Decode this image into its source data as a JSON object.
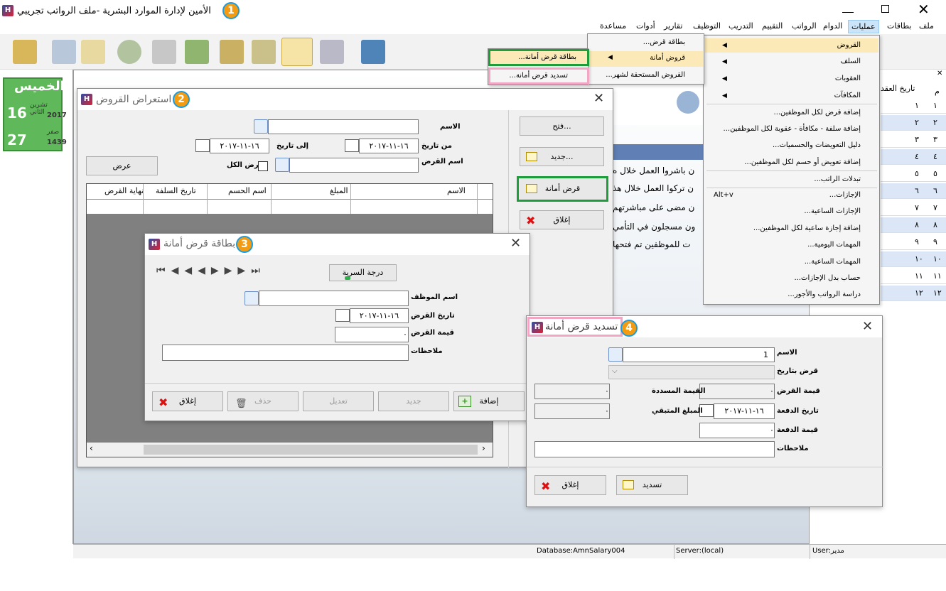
{
  "app": {
    "title": "الأمين لإدارة الموارد البشرية -ملف الرواتب تجريبي",
    "markers": [
      "1",
      "2",
      "3",
      "4"
    ]
  },
  "menubar": {
    "items": [
      "ملف",
      "بطاقات",
      "عمليات",
      "الدوام",
      "الرواتب",
      "التقييم",
      "التدريب",
      "التوظيف",
      "تقارير",
      "أدوات",
      "مساعدة"
    ]
  },
  "calendar": {
    "day": "الخميس",
    "greg_day": "16",
    "greg_month": "تشرين الثاني",
    "greg_year": "2017",
    "hijri_day": "27",
    "hijri_month": "صفر",
    "hijri_year": "1439"
  },
  "operations_menu": {
    "items": [
      {
        "label": "القروض",
        "has_sub": true,
        "highlighted": true
      },
      {
        "label": "السلف",
        "has_sub": true
      },
      {
        "label": "العقوبات",
        "has_sub": true
      },
      {
        "label": "المكافآت",
        "has_sub": true
      },
      {
        "label": "إضافة قرض لكل الموظفين..."
      },
      {
        "label": "إضافة سلفة - مكافأة - عقوبة لكل الموظفين..."
      },
      {
        "label": "دليل التعويضات والحسميات..."
      },
      {
        "label": "إضافة تعويض أو حسم لكل الموظفين..."
      },
      {
        "label": "تبدلات الراتب..."
      },
      {
        "label": "الإجازات...",
        "shortcut": "Alt+v"
      },
      {
        "label": "الإجازات الساعية..."
      },
      {
        "label": "إضافة إجازة ساعية لكل الموظفين..."
      },
      {
        "label": "المهمات اليومية..."
      },
      {
        "label": "المهمات الساعية..."
      },
      {
        "label": "حساب بدل الإجازات..."
      },
      {
        "label": "دراسة الرواتب والأجور..."
      }
    ]
  },
  "loans_submenu": {
    "items": [
      "بطاقة قرض...",
      "قروض أمانة",
      "القروض المستحقة لشهر..."
    ]
  },
  "amana_submenu": {
    "items": [
      "بطاقة قرض أمانة...",
      "تسديد قرض أمانة..."
    ]
  },
  "background_table": {
    "header_no": "م",
    "header_date": "تاريخ العقد",
    "rows": [
      "١",
      "٢",
      "٣",
      "٤",
      "٥",
      "٦",
      "٧",
      "٨",
      "٩",
      "١٠",
      "١١",
      "١٢"
    ]
  },
  "background_text": [
    "ن باشروا العمل خلال ه",
    "ن تركوا العمل خلال هذ",
    "ن مضى على مباشرتهم",
    "ون مسجلون في التأمي",
    "ت للموظفين تم فتحها"
  ],
  "loans_window": {
    "title": "استعراض القروض",
    "name_label": "الاسم",
    "from_label": "من تاريخ",
    "from_value": "١٦-١١-٢٠١٧",
    "to_label": "إلى تاريخ",
    "to_value": "١٦-١١-٢٠١٧",
    "loan_name_label": "اسم القرض",
    "show_all_label": "عرض الكل",
    "show_button": "عرض",
    "open_button": "فتح...",
    "new_button": "جديد...",
    "amana_button": "قرض أمانة",
    "close_button": "إغلاق",
    "columns": [
      "الاسم",
      "المبلغ",
      "اسم الحسم",
      "تاريخ السلفة",
      "نهاية القرض"
    ]
  },
  "amana_card": {
    "title": "بطاقة قرض أمانة",
    "secrecy_button": "درجة السرية",
    "employee_label": "اسم الموظف",
    "date_label": "تاريخ القرض",
    "date_value": "١٦-١١-٢٠١٧",
    "value_label": "قيمة القرض",
    "value_value": "٠",
    "notes_label": "ملاحظات",
    "add_button": "إضافة",
    "new_button": "جديد",
    "edit_button": "تعديل",
    "delete_button": "حذف",
    "close_button": "إغلاق"
  },
  "repay_window": {
    "title": "تسديد قرض أمانة",
    "name_label": "الاسم",
    "name_value": "1",
    "loan_date_label": "قرض بتاريخ",
    "loan_value_label": "قيمة القرض",
    "loan_value": "٠",
    "paid_label": "القيمة المسددة",
    "paid_value": "٠",
    "payment_date_label": "تاريخ الدفعة",
    "payment_date_value": "١٦-١١-٢٠١٧",
    "remaining_label": "المبلغ المتبقي",
    "remaining_value": "٠",
    "payment_value_label": "قيمة الدفعة",
    "payment_value": "٠",
    "notes_label": "ملاحظات",
    "repay_button": "تسديد",
    "close_button": "إغلاق"
  },
  "statusbar": {
    "database": "Database:AmnSalary004",
    "server": "Server:(local)",
    "user": "User:مدير"
  },
  "colors": {
    "accent_green": "#1e9e3a",
    "accent_pink": "#f2a6c4",
    "marker_orange": "#f39c12",
    "marker_border": "#1a9be0"
  }
}
